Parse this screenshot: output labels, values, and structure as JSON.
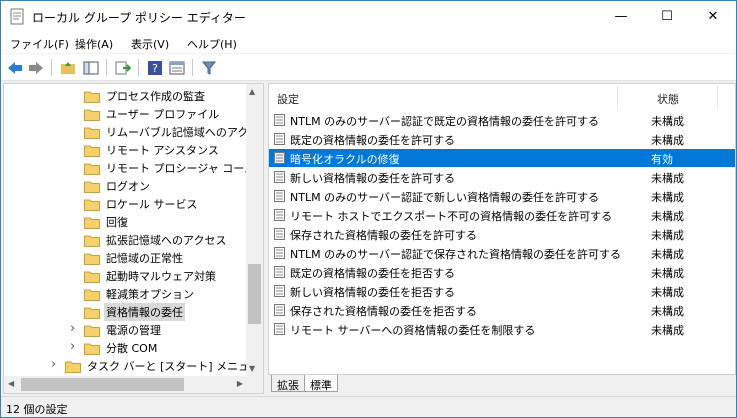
{
  "window": {
    "title": "ローカル グループ ポリシー エディター",
    "minimize": "—",
    "maximize": "☐",
    "close": "✕"
  },
  "menu": [
    "ファイル(F)",
    "操作(A)",
    "表示(V)",
    "ヘルプ(H)"
  ],
  "toolbar": {
    "icons": [
      "back-icon",
      "forward-icon",
      "up-folder-icon",
      "show-hide-tree-icon",
      "export-list-icon",
      "help-icon",
      "properties-icon",
      "filter-icon"
    ]
  },
  "tree": {
    "items": [
      {
        "label": "プロセス作成の監査"
      },
      {
        "label": "ユーザー プロファイル"
      },
      {
        "label": "リムーバブル記憶域へのアクセス"
      },
      {
        "label": "リモート アシスタンス"
      },
      {
        "label": "リモート プロシージャ コール"
      },
      {
        "label": "ログオン"
      },
      {
        "label": "ロケール サービス"
      },
      {
        "label": "回復"
      },
      {
        "label": "拡張記憶域へのアクセス"
      },
      {
        "label": "記憶域の正常性"
      },
      {
        "label": "起動時マルウェア対策"
      },
      {
        "label": "軽減策オプション"
      },
      {
        "label": "資格情報の委任"
      },
      {
        "label": "電源の管理"
      },
      {
        "label": "分散 COM"
      },
      {
        "label": "タスク バーと [スタート] メニュー"
      }
    ]
  },
  "list": {
    "columns": {
      "setting": "設定",
      "state": "状態"
    },
    "rows": [
      {
        "name": "NTLM のみのサーバー認証で既定の資格情報の委任を許可する",
        "state": "未構成"
      },
      {
        "name": "既定の資格情報の委任を許可する",
        "state": "未構成"
      },
      {
        "name": "暗号化オラクルの修復",
        "state": "有効"
      },
      {
        "name": "新しい資格情報の委任を許可する",
        "state": "未構成"
      },
      {
        "name": "NTLM のみのサーバー認証で新しい資格情報の委任を許可する",
        "state": "未構成"
      },
      {
        "name": "リモート ホストでエクスポート不可の資格情報の委任を許可する",
        "state": "未構成"
      },
      {
        "name": "保存された資格情報の委任を許可する",
        "state": "未構成"
      },
      {
        "name": "NTLM のみのサーバー認証で保存された資格情報の委任を許可する",
        "state": "未構成"
      },
      {
        "name": "既定の資格情報の委任を拒否する",
        "state": "未構成"
      },
      {
        "name": "新しい資格情報の委任を拒否する",
        "state": "未構成"
      },
      {
        "name": "保存された資格情報の委任を拒否する",
        "state": "未構成"
      },
      {
        "name": "リモート サーバーへの資格情報の委任を制限する",
        "state": "未構成"
      }
    ]
  },
  "tabs": [
    "拡張",
    "標準"
  ],
  "status": {
    "text": "12 個の設定"
  },
  "colors": {
    "selection": "#0078d7",
    "folder": "#f4d06f",
    "tree_selection": "#d9d9d9"
  }
}
